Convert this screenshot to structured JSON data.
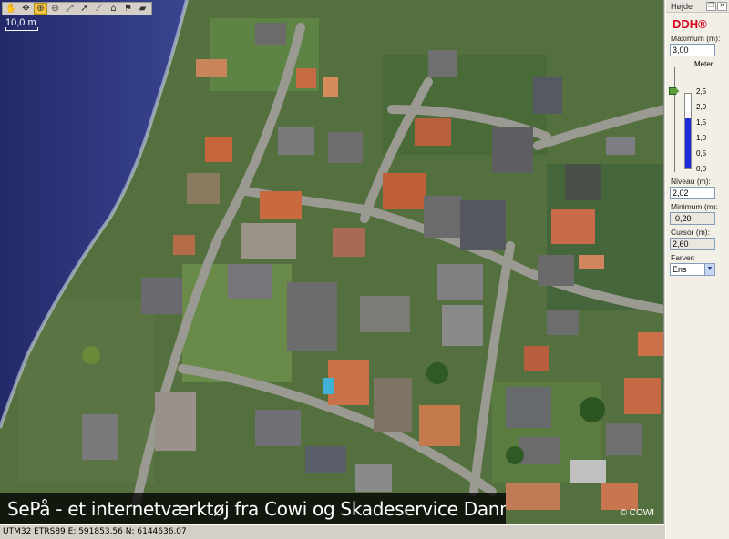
{
  "toolbar": {
    "tools": [
      {
        "name": "pan-tool-icon",
        "glyph": "✋",
        "active": false
      },
      {
        "name": "full-extent-icon",
        "glyph": "✥",
        "active": false
      },
      {
        "name": "zoom-in-icon",
        "glyph": "⊕",
        "active": true
      },
      {
        "name": "zoom-out-icon",
        "glyph": "⊖",
        "active": false
      },
      {
        "name": "zoom-extent-icon",
        "glyph": "⤢",
        "active": false
      },
      {
        "name": "select-arrow-icon",
        "glyph": "➚",
        "active": false
      },
      {
        "name": "measure-icon",
        "glyph": "⟋",
        "active": false
      },
      {
        "name": "house-flag-icon",
        "glyph": "⌂",
        "active": false
      },
      {
        "name": "bookmark-icon",
        "glyph": "⚑",
        "active": false
      },
      {
        "name": "open-folder-icon",
        "glyph": "▰",
        "active": false
      }
    ]
  },
  "map": {
    "scale_label": "10,0 m",
    "caption": "SePå - et internetværktøj fra Cowi og Skadeservice Danmark",
    "copyright": "© COWI"
  },
  "statusbar": {
    "coords": "UTM32 ETRS89 E: 591853,56  N: 6144636,07"
  },
  "panel": {
    "title": "Højde",
    "logo": "DDH®",
    "maximum_label": "Maximum (m):",
    "maximum_value": "3,00",
    "meter_label": "Meter",
    "ticks": [
      "2,5",
      "2,0",
      "1,5",
      "1,0",
      "0,5",
      "0,0"
    ],
    "level_fraction": 0.67,
    "niveau_label": "Niveau (m):",
    "niveau_value": "2,02",
    "minimum_label": "Minimum (m):",
    "minimum_value": "-0,20",
    "cursor_label": "Cursor (m):",
    "cursor_value": "2,60",
    "farver_label": "Farver:",
    "farver_value": "Ens",
    "colors": {
      "gauge": "#1f2bd6",
      "logo": "#d9001b",
      "thumb": "#5c9e3c"
    }
  }
}
